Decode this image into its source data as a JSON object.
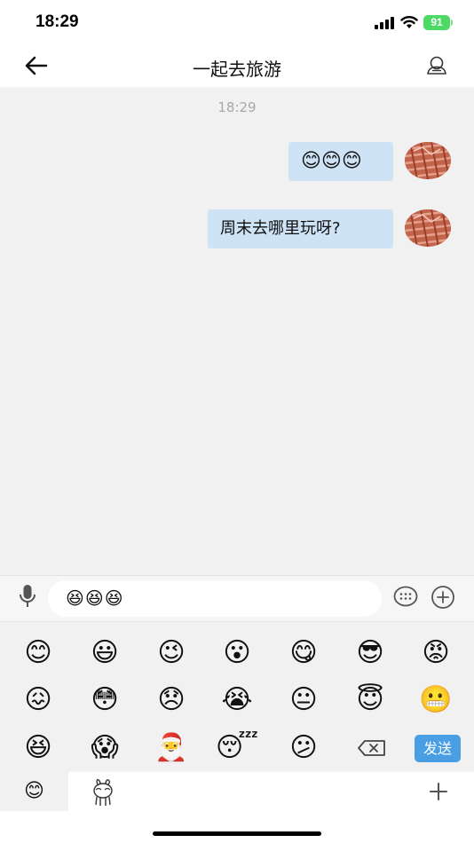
{
  "status_bar": {
    "time": "18:29",
    "battery": "91"
  },
  "nav": {
    "title": "一起去旅游"
  },
  "chat": {
    "timestamp": "18:29",
    "messages": [
      {
        "text": "😊😊😊"
      },
      {
        "text": "周末去哪里玩呀?"
      }
    ]
  },
  "input": {
    "value": "😆😆😆"
  },
  "emoji_panel": {
    "emojis": [
      "😊",
      "😃",
      "😉",
      "😮",
      "😋",
      "😎",
      "😡",
      "😖",
      "😳",
      "😞",
      "😭",
      "😐",
      "😇",
      "😬",
      "😆",
      "😱",
      "🎅",
      "😴",
      "😕"
    ],
    "send_label": "发送"
  },
  "tabs": {
    "emoji_tab": "😊"
  }
}
